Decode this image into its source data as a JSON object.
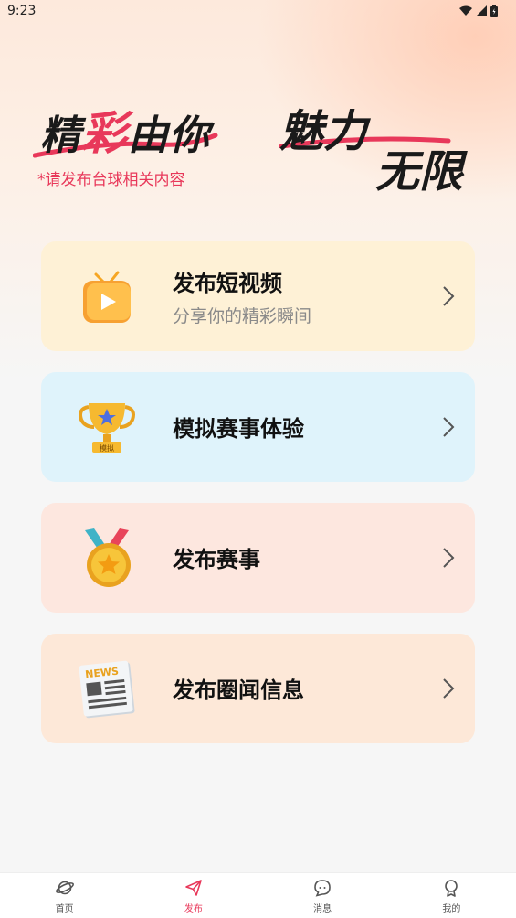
{
  "status": {
    "time": "9:23"
  },
  "banner": {
    "slogan_a_pre": "精",
    "slogan_a_hl": "彩",
    "slogan_a_post": "由你",
    "slogan_b1": "魅力",
    "slogan_b2": "无限",
    "hint": "*请发布台球相关内容"
  },
  "cards": [
    {
      "title": "发布短视频",
      "subtitle": "分享你的精彩瞬间",
      "bg": "#fef1d6",
      "icon": "video-tv-icon"
    },
    {
      "title": "模拟赛事体验",
      "subtitle": "",
      "bg": "#dff3fb",
      "icon": "trophy-icon"
    },
    {
      "title": "发布赛事",
      "subtitle": "",
      "bg": "#fde7df",
      "icon": "medal-icon"
    },
    {
      "title": "发布圈闻信息",
      "subtitle": "",
      "bg": "#fde8d8",
      "icon": "newspaper-icon"
    }
  ],
  "trophy_badge": "模拟",
  "news_badge": "NEWS",
  "tabs": [
    {
      "label": "首页",
      "icon": "planet-icon",
      "active": false
    },
    {
      "label": "发布",
      "icon": "send-icon",
      "active": true
    },
    {
      "label": "消息",
      "icon": "chat-icon",
      "active": false
    },
    {
      "label": "我的",
      "icon": "profile-icon",
      "active": false
    }
  ],
  "colors": {
    "accent": "#e8385a"
  }
}
